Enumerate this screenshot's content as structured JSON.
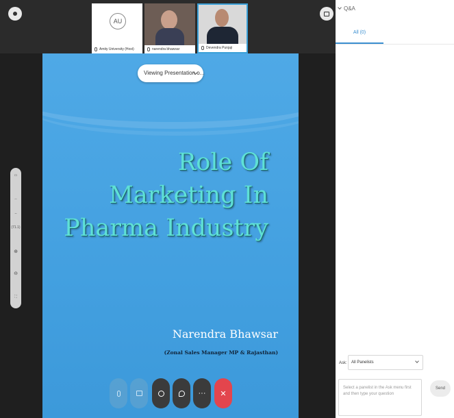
{
  "video_strip": {
    "tiles": [
      {
        "avatar_initials": "AU",
        "label": "Amity University (Host)"
      },
      {
        "label": "narendra bhawsar"
      },
      {
        "label": "Devendra Punjaji"
      }
    ]
  },
  "presentation": {
    "viewing_label": "Viewing Presentation o...",
    "slide": {
      "title_line1": "Role Of Marketing In",
      "title_line2": "Pharma Industry",
      "presenter_name": "Narendra Bhawsar",
      "presenter_role": "(Zonal Sales Manager MP & Rajasthan)"
    }
  },
  "zoom_toolbar": {
    "zoom_level": "(71.1)"
  },
  "controls": {
    "icons": [
      "mute-icon",
      "share-icon",
      "participants-icon",
      "chat-icon",
      "more-icon",
      "leave-icon"
    ]
  },
  "qa_panel": {
    "header": "Q&A",
    "tab_all": "All (0)",
    "ask_label": "Ask:",
    "ask_recipient": "All Panelists",
    "question_placeholder": "Select a panelist in the Ask menu first and then type your question",
    "send_label": "Send"
  },
  "colors": {
    "slide_background": "#43a0e0",
    "title_color": "#5fe0d6",
    "accent": "#3a8fd0",
    "leave": "#e3454d"
  }
}
